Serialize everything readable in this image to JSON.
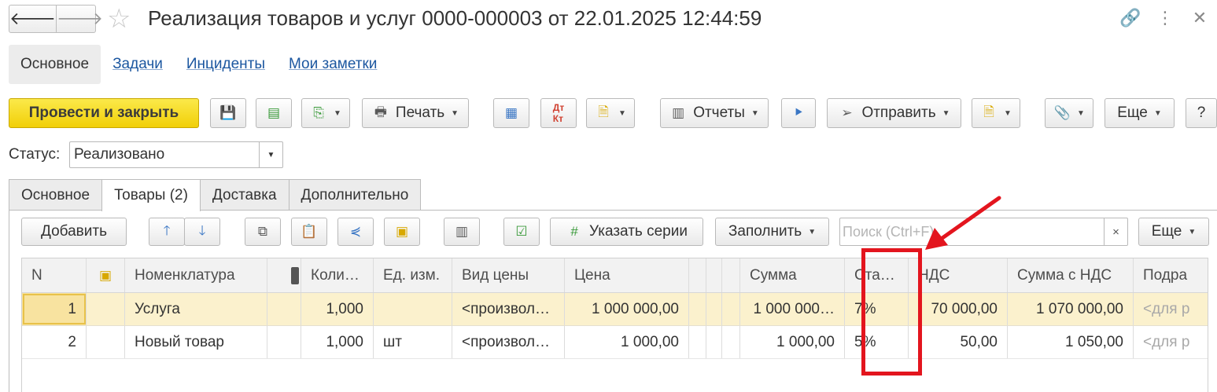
{
  "window": {
    "title": "Реализация товаров и услуг 0000-000003 от 22.01.2025 12:44:59"
  },
  "sections": [
    "Основное",
    "Задачи",
    "Инциденты",
    "Мои заметки"
  ],
  "toolbar": {
    "post_close": "Провести и закрыть",
    "print": "Печать",
    "reports": "Отчеты",
    "send": "Отправить",
    "more": "Еще",
    "help": "?"
  },
  "status": {
    "label": "Статус:",
    "value": "Реализовано"
  },
  "tabs": [
    "Основное",
    "Товары (2)",
    "Доставка",
    "Дополнительно"
  ],
  "table_toolbar": {
    "add": "Добавить",
    "series": "Указать серии",
    "fill": "Заполнить",
    "search_placeholder": "Поиск (Ctrl+F)",
    "clear": "×",
    "more": "Еще"
  },
  "grid": {
    "headers": [
      "N",
      "",
      "Номенклатура",
      "",
      "Коли…",
      "Ед. изм.",
      "Вид цены",
      "Цена",
      "",
      "",
      "",
      "Сумма",
      "Ста…",
      "НДС",
      "Сумма с НДС",
      "Подра"
    ],
    "rows": [
      [
        "1",
        "",
        "Услуга",
        "",
        "1,000",
        "",
        "<произвол…",
        "1 000 000,00",
        "",
        "",
        "",
        "1 000 000…",
        "7%",
        "70 000,00",
        "1 070 000,00",
        "<для р"
      ],
      [
        "2",
        "",
        "Новый товар",
        "",
        "1,000",
        "шт",
        "<произвол…",
        "1 000,00",
        "",
        "",
        "",
        "1 000,00",
        "5%",
        "50,00",
        "1 050,00",
        "<для р"
      ]
    ]
  },
  "colors": {
    "primary_button": "#f3d414",
    "selected_row": "#fbf1cd",
    "annotation": "#e3151e",
    "link": "#1c57a0"
  }
}
